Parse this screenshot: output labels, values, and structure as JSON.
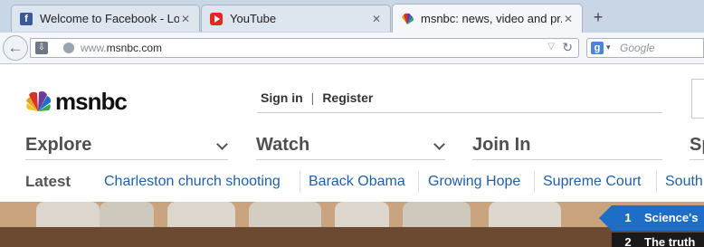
{
  "browser": {
    "tabs": [
      {
        "title": "Welcome to Facebook - Lo...",
        "icon": "facebook-icon",
        "close": "✕"
      },
      {
        "title": "YouTube",
        "icon": "youtube-icon",
        "close": "✕"
      },
      {
        "title": "msnbc: news, video and pr...",
        "icon": "nbc-peacock-icon",
        "close": "✕"
      }
    ],
    "new_tab": "+",
    "url": {
      "prefix": "www.",
      "domain": "msnbc.com"
    },
    "search": {
      "engine_badge": "g",
      "placeholder": "Google"
    }
  },
  "site": {
    "brand": "msnbc",
    "account": {
      "sign_in": "Sign in",
      "separator": "|",
      "register": "Register"
    },
    "menu": [
      "Explore",
      "Watch",
      "Join In",
      "Sp"
    ],
    "latest_label": "Latest",
    "topics": [
      "Charleston church shooting",
      "Barack Obama",
      "Growing Hope",
      "Supreme Court",
      "South"
    ],
    "trending": [
      {
        "rank": "1",
        "title": "Science's"
      },
      {
        "rank": "2",
        "title": "The truth"
      }
    ]
  },
  "colors": {
    "link": "#1f5fa8",
    "trend_active": "#1e6ec7",
    "brand_text": "#111111"
  }
}
